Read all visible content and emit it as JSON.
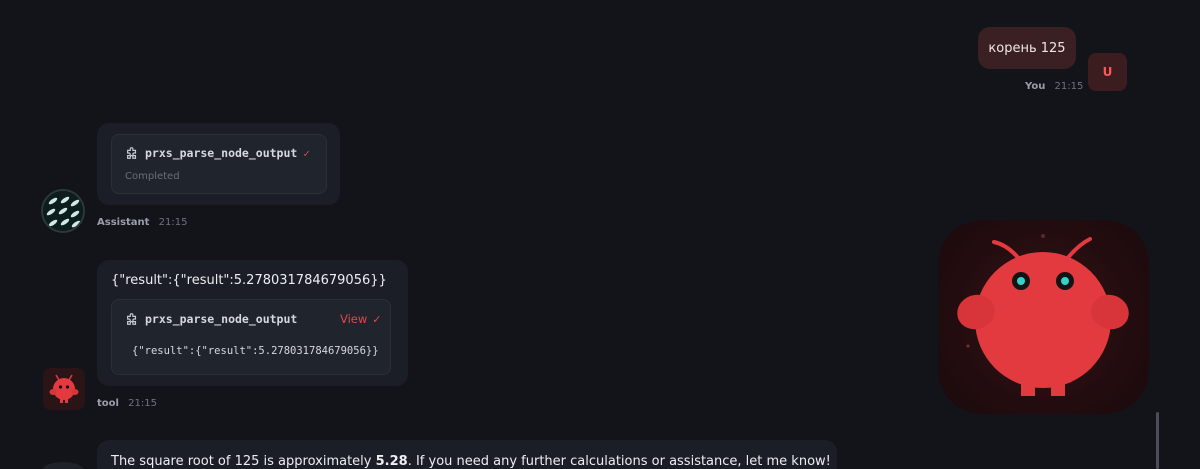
{
  "user_message": {
    "text": "корень 125",
    "sender": "You",
    "time": "21:15",
    "avatar_letter": "U"
  },
  "assistant_message": {
    "tool_name": "prxs_parse_node_output",
    "status": "Completed",
    "sender": "Assistant",
    "time": "21:15"
  },
  "tool_message": {
    "result_text": "{\"result\":{\"result\":5.278031784679056}}",
    "tool_name": "prxs_parse_node_output",
    "view_label": "View",
    "output_text": "{\"result\":{\"result\":5.278031784679056}}",
    "sender": "tool",
    "time": "21:15"
  },
  "final_message": {
    "text_before": "The square root of 125 is approximately ",
    "bold_value": "5.28",
    "text_after": ". If you need any further calculations or assistance, let me know!"
  },
  "icons": {
    "tool": "puzzle-icon",
    "done": "check-icon"
  },
  "colors": {
    "background": "#131419",
    "accent": "#e0474d",
    "mascot": "#e23a3f"
  }
}
